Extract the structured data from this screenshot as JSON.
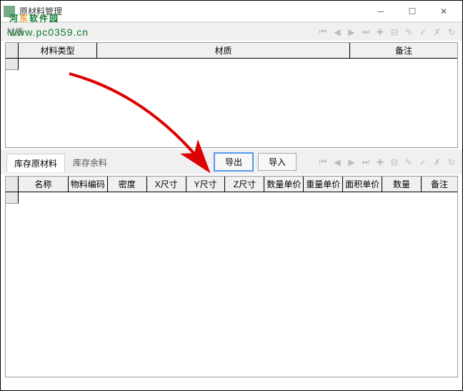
{
  "window": {
    "title": "原材料管理"
  },
  "watermark": {
    "text_prefix": "河",
    "text_orange": "东",
    "text_suffix": "软件园",
    "url": "www.pc0359.cn"
  },
  "top_section": {
    "label": "材质",
    "columns": {
      "type": "材料类型",
      "material": "材质",
      "remark": "备注"
    }
  },
  "mid_bar": {
    "tab1": "库存原材料",
    "tab2": "库存余料",
    "export": "导出",
    "import": "导入"
  },
  "bottom_grid": {
    "columns": {
      "name": "名称",
      "code": "物料编码",
      "density": "密度",
      "x": "X尺寸",
      "y": "Y尺寸",
      "z": "Z尺寸",
      "qty_price": "数量单价",
      "weight_price": "重量单价",
      "area_price": "面积单价",
      "qty": "数量",
      "remark": "备注"
    }
  },
  "nav_glyphs": {
    "first": "⏮",
    "prev": "◀",
    "next": "▶",
    "last": "⏭",
    "add": "✚",
    "del": "⊟",
    "edit": "✎",
    "ok": "✓",
    "cancel": "✗",
    "refresh": "↻"
  }
}
